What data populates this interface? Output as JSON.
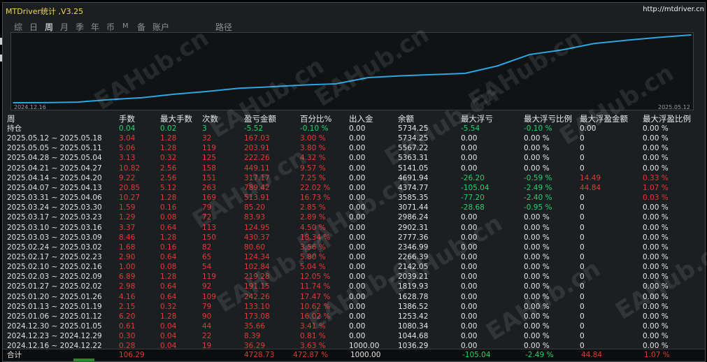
{
  "window": {
    "title": "MTDriver统计 ,V3.25",
    "url": "http://mtdriver.cn"
  },
  "tabs": [
    {
      "label": "综",
      "active": false
    },
    {
      "label": "日",
      "active": false
    },
    {
      "label": "周",
      "active": true
    },
    {
      "label": "月",
      "active": false
    },
    {
      "label": "季",
      "active": false
    },
    {
      "label": "年",
      "active": false
    },
    {
      "label": "币",
      "active": false
    },
    {
      "label": "M",
      "active": false
    },
    {
      "label": "备",
      "active": false
    },
    {
      "label": "账户",
      "active": false
    },
    {
      "label": "路径",
      "active": false
    }
  ],
  "watermark": "EAHub.cn",
  "colors": {
    "accent_line": "#2aa6e3",
    "positive": "#e03a35",
    "negative": "#21d46b",
    "neutral": "#e6e6e6"
  },
  "chart_data": {
    "type": "line",
    "x_start_label": "2024.12.16",
    "x_end_label": "2025.05.12",
    "series": [
      {
        "values": [
          1036.29,
          1044.68,
          1080.34,
          1253.42,
          1386.52,
          1628.78,
          1819.93,
          2039.21,
          2142.05,
          2266.39,
          2346.99,
          2777.36,
          2902.31,
          2986.24,
          3071.44,
          3585.35,
          4374.77,
          4691.94,
          5141.05,
          5363.31,
          5567.22,
          5734.25
        ]
      }
    ]
  },
  "table": {
    "headers": [
      "周",
      "手数",
      "最大手数",
      "次数",
      "盈亏金额",
      "百分比%",
      "出入金",
      "余额",
      "最大浮亏",
      "最大浮亏比例",
      "最大浮盈金额",
      "最大浮盈比例"
    ],
    "rows": [
      {
        "week": "持仓",
        "lots": "0.04",
        "max_lots": "0.02",
        "count": "3",
        "pnl": "-5.52",
        "pct": "-0.10 %",
        "deposit": "0.00",
        "balance": "5734.25",
        "max_dd": "-5.54",
        "max_dd_pct": "-0.10 %",
        "max_fp": "0.00",
        "max_fp_pct": "0.00 %",
        "tone": "green"
      },
      {
        "week": "2025.05.12 ~ 2025.05.18",
        "lots": "3.04",
        "max_lots": "1.28",
        "count": "32",
        "pnl": "167.03",
        "pct": "3.00 %",
        "deposit": "0.00",
        "balance": "5734.25",
        "max_dd": "0.00",
        "max_dd_pct": "0.00 %",
        "max_fp": "0",
        "max_fp_pct": "0.00 %",
        "tone": "red"
      },
      {
        "week": "2025.05.05 ~ 2025.05.11",
        "lots": "5.06",
        "max_lots": "1.28",
        "count": "119",
        "pnl": "203.91",
        "pct": "3.80 %",
        "deposit": "0.00",
        "balance": "5567.22",
        "max_dd": "0.00",
        "max_dd_pct": "0.00 %",
        "max_fp": "0",
        "max_fp_pct": "0.00 %",
        "tone": "red"
      },
      {
        "week": "2025.04.28 ~ 2025.05.04",
        "lots": "3.13",
        "max_lots": "0.32",
        "count": "125",
        "pnl": "222.26",
        "pct": "4.32 %",
        "deposit": "0.00",
        "balance": "5363.31",
        "max_dd": "0.00",
        "max_dd_pct": "0.00 %",
        "max_fp": "0",
        "max_fp_pct": "0.00 %",
        "tone": "red"
      },
      {
        "week": "2025.04.21 ~ 2025.04.27",
        "lots": "10.82",
        "max_lots": "2.56",
        "count": "158",
        "pnl": "449.11",
        "pct": "9.57 %",
        "deposit": "0.00",
        "balance": "5141.05",
        "max_dd": "0.00",
        "max_dd_pct": "0.00 %",
        "max_fp": "0",
        "max_fp_pct": "0.00 %",
        "tone": "red"
      },
      {
        "week": "2025.04.14 ~ 2025.04.20",
        "lots": "9.22",
        "max_lots": "2.56",
        "count": "151",
        "pnl": "317.17",
        "pct": "7.25 %",
        "deposit": "0.00",
        "balance": "4691.94",
        "max_dd": "-26.20",
        "max_dd_pct": "-0.59 %",
        "max_fp": "14.49",
        "max_fp_pct": "0.33 %",
        "tone": "red"
      },
      {
        "week": "2025.04.07 ~ 2025.04.13",
        "lots": "20.85",
        "max_lots": "5.12",
        "count": "263",
        "pnl": "789.42",
        "pct": "22.02 %",
        "deposit": "0.00",
        "balance": "4374.77",
        "max_dd": "-105.04",
        "max_dd_pct": "-2.49 %",
        "max_fp": "44.84",
        "max_fp_pct": "1.07 %",
        "tone": "red"
      },
      {
        "week": "2025.03.31 ~ 2025.04.06",
        "lots": "10.27",
        "max_lots": "1.28",
        "count": "169",
        "pnl": "513.91",
        "pct": "16.73 %",
        "deposit": "0.00",
        "balance": "3585.35",
        "max_dd": "-77.20",
        "max_dd_pct": "-2.40 %",
        "max_fp": "0",
        "max_fp_pct": "0.03 %",
        "tone": "red"
      },
      {
        "week": "2025.03.24 ~ 2025.03.30",
        "lots": "1.59",
        "max_lots": "0.16",
        "count": "79",
        "pnl": "85.20",
        "pct": "2.85 %",
        "deposit": "0.00",
        "balance": "3071.44",
        "max_dd": "-28.68",
        "max_dd_pct": "-0.95 %",
        "max_fp": "0",
        "max_fp_pct": "0.00 %",
        "tone": "red"
      },
      {
        "week": "2025.03.17 ~ 2025.03.23",
        "lots": "1.29",
        "max_lots": "0.08",
        "count": "72",
        "pnl": "83.93",
        "pct": "2.89 %",
        "deposit": "0.00",
        "balance": "2986.24",
        "max_dd": "0.00",
        "max_dd_pct": "0.00 %",
        "max_fp": "0",
        "max_fp_pct": "0.00 %",
        "tone": "red"
      },
      {
        "week": "2025.03.10 ~ 2025.03.16",
        "lots": "3.37",
        "max_lots": "0.64",
        "count": "113",
        "pnl": "124.95",
        "pct": "4.50 %",
        "deposit": "0.00",
        "balance": "2902.31",
        "max_dd": "0.00",
        "max_dd_pct": "0.00 %",
        "max_fp": "0",
        "max_fp_pct": "0.00 %",
        "tone": "red"
      },
      {
        "week": "2025.03.03 ~ 2025.03.09",
        "lots": "8.46",
        "max_lots": "1.28",
        "count": "150",
        "pnl": "430.37",
        "pct": "18.34 %",
        "deposit": "0.00",
        "balance": "2777.36",
        "max_dd": "0.00",
        "max_dd_pct": "0.00 %",
        "max_fp": "0",
        "max_fp_pct": "0.00 %",
        "tone": "red"
      },
      {
        "week": "2025.02.24 ~ 2025.03.02",
        "lots": "1.68",
        "max_lots": "0.16",
        "count": "82",
        "pnl": "80.60",
        "pct": "3.56 %",
        "deposit": "0.00",
        "balance": "2346.99",
        "max_dd": "0.00",
        "max_dd_pct": "0.00 %",
        "max_fp": "0",
        "max_fp_pct": "0.00 %",
        "tone": "red"
      },
      {
        "week": "2025.02.17 ~ 2025.02.23",
        "lots": "2.90",
        "max_lots": "0.64",
        "count": "65",
        "pnl": "124.34",
        "pct": "5.80 %",
        "deposit": "0.00",
        "balance": "2266.39",
        "max_dd": "0.00",
        "max_dd_pct": "0.00 %",
        "max_fp": "0",
        "max_fp_pct": "0.00 %",
        "tone": "red"
      },
      {
        "week": "2025.02.10 ~ 2025.02.16",
        "lots": "1.00",
        "max_lots": "0.08",
        "count": "54",
        "pnl": "102.84",
        "pct": "5.04 %",
        "deposit": "0.00",
        "balance": "2142.05",
        "max_dd": "0.00",
        "max_dd_pct": "0.00 %",
        "max_fp": "0",
        "max_fp_pct": "0.00 %",
        "tone": "red"
      },
      {
        "week": "2025.02.03 ~ 2025.02.09",
        "lots": "6.89",
        "max_lots": "1.28",
        "count": "119",
        "pnl": "219.28",
        "pct": "12.05 %",
        "deposit": "0.00",
        "balance": "2039.21",
        "max_dd": "0.00",
        "max_dd_pct": "0.00 %",
        "max_fp": "0",
        "max_fp_pct": "0.00 %",
        "tone": "red"
      },
      {
        "week": "2025.01.27 ~ 2025.02.02",
        "lots": "2.98",
        "max_lots": "0.64",
        "count": "92",
        "pnl": "191.15",
        "pct": "11.74 %",
        "deposit": "0.00",
        "balance": "1819.93",
        "max_dd": "0.00",
        "max_dd_pct": "0.00 %",
        "max_fp": "0",
        "max_fp_pct": "0.00 %",
        "tone": "red"
      },
      {
        "week": "2025.01.20 ~ 2025.01.26",
        "lots": "4.16",
        "max_lots": "0.64",
        "count": "109",
        "pnl": "242.26",
        "pct": "17.47 %",
        "deposit": "0.00",
        "balance": "1628.78",
        "max_dd": "0.00",
        "max_dd_pct": "0.00 %",
        "max_fp": "0",
        "max_fp_pct": "0.00 %",
        "tone": "red"
      },
      {
        "week": "2025.01.13 ~ 2025.01.19",
        "lots": "2.15",
        "max_lots": "0.32",
        "count": "79",
        "pnl": "133.10",
        "pct": "10.62 %",
        "deposit": "0.00",
        "balance": "1386.52",
        "max_dd": "0.00",
        "max_dd_pct": "0.00 %",
        "max_fp": "0",
        "max_fp_pct": "0.00 %",
        "tone": "red"
      },
      {
        "week": "2025.01.06 ~ 2025.01.12",
        "lots": "6.20",
        "max_lots": "1.28",
        "count": "90",
        "pnl": "173.08",
        "pct": "16.02 %",
        "deposit": "0.00",
        "balance": "1253.42",
        "max_dd": "0.00",
        "max_dd_pct": "0.00 %",
        "max_fp": "0",
        "max_fp_pct": "0.00 %",
        "tone": "red"
      },
      {
        "week": "2024.12.30 ~ 2025.01.05",
        "lots": "0.61",
        "max_lots": "0.04",
        "count": "44",
        "pnl": "35.66",
        "pct": "3.41 %",
        "deposit": "0.00",
        "balance": "1080.34",
        "max_dd": "0.00",
        "max_dd_pct": "0.00 %",
        "max_fp": "0",
        "max_fp_pct": "0.00 %",
        "tone": "red"
      },
      {
        "week": "2024.12.23 ~ 2024.12.29",
        "lots": "0.30",
        "max_lots": "0.04",
        "count": "22",
        "pnl": "8.39",
        "pct": "0.81 %",
        "deposit": "0.00",
        "balance": "1044.68",
        "max_dd": "0.00",
        "max_dd_pct": "0.00 %",
        "max_fp": "0",
        "max_fp_pct": "0.00 %",
        "tone": "red"
      },
      {
        "week": "2024.12.16 ~ 2024.12.22",
        "lots": "0.28",
        "max_lots": "0.04",
        "count": "19",
        "pnl": "36.29",
        "pct": "3.63 %",
        "deposit": "1000.00",
        "balance": "1036.29",
        "max_dd": "0.00",
        "max_dd_pct": "0.00 %",
        "max_fp": "0",
        "max_fp_pct": "0.00 %",
        "tone": "red"
      }
    ],
    "total": {
      "week": "合计",
      "lots": "106.29",
      "pnl": "4728.73",
      "pct": "472.87 %",
      "deposit": "1000.00",
      "max_dd": "-105.04",
      "max_dd_pct": "-2.49 %",
      "max_fp": "44.84",
      "max_fp_pct": "1.07 %"
    }
  }
}
